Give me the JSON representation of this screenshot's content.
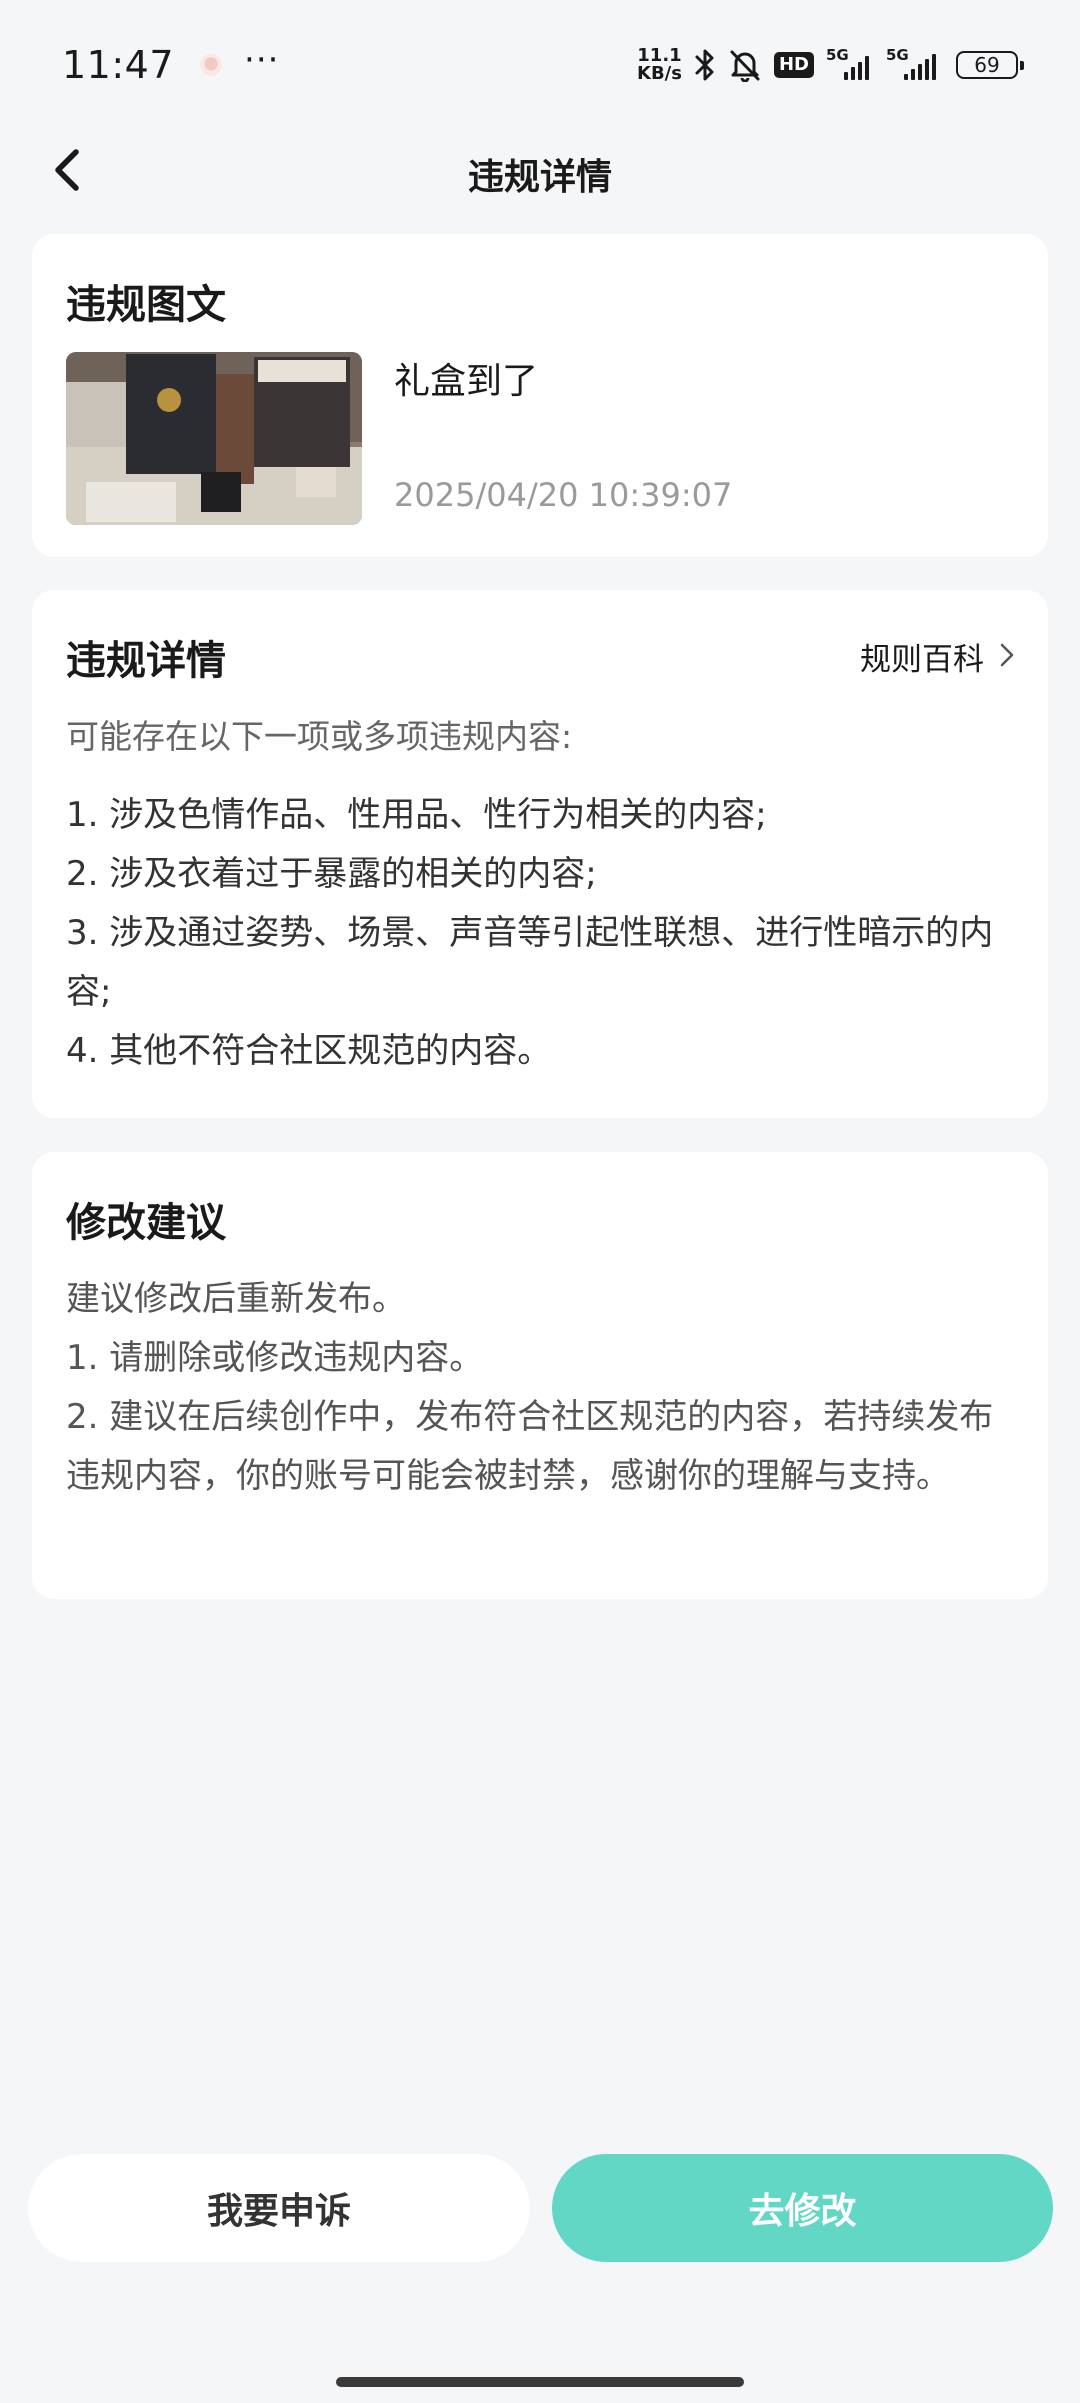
{
  "status_bar": {
    "time": "11:47",
    "more": "···",
    "net_speed_value": "11.1",
    "net_speed_unit": "KB/s",
    "hd_label": "HD",
    "signal1_label": "5G",
    "signal2_label": "5G",
    "battery": "69"
  },
  "header": {
    "title": "违规详情"
  },
  "post_card": {
    "title": "违规图文",
    "text": "礼盒到了",
    "time": "2025/04/20 10:39:07"
  },
  "detail_card": {
    "title": "违规详情",
    "rules_link": "规则百科",
    "intro": "可能存在以下一项或多项违规内容:",
    "items": [
      "1. 涉及色情作品、性用品、性行为相关的内容;",
      "2. 涉及衣着过于暴露的相关的内容;",
      "3. 涉及通过姿势、场景、声音等引起性联想、进行性暗示的内容;",
      "4. 其他不符合社区规范的内容。"
    ]
  },
  "suggest_card": {
    "title": "修改建议",
    "lines": [
      "建议修改后重新发布。",
      "1. 请删除或修改违规内容。",
      "2. 建议在后续创作中，发布符合社区规范的内容，若持续发布违规内容，你的账号可能会被封禁，感谢你的理解与支持。"
    ]
  },
  "buttons": {
    "appeal": "我要申诉",
    "edit": "去修改"
  },
  "colors": {
    "accent": "#62d7c5",
    "background": "#f5f6f8"
  }
}
